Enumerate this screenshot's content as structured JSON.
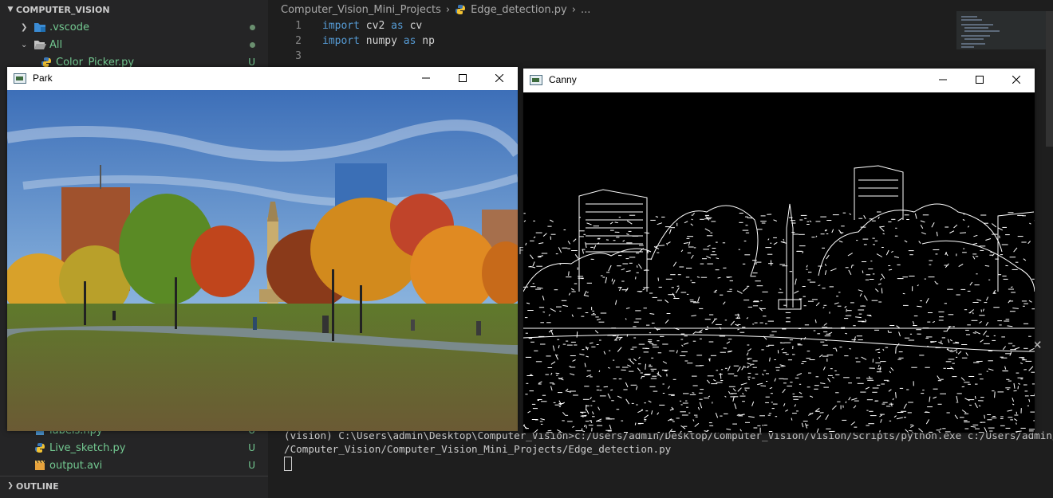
{
  "explorer": {
    "root_label": "COMPUTER_VISION",
    "items": [
      {
        "label": ".vscode",
        "status": "dot"
      },
      {
        "label": "All",
        "status": "dot"
      },
      {
        "label": "Color_Picker.py",
        "status": "U"
      },
      {
        "label": "labels.npy",
        "status": "U"
      },
      {
        "label": "Live_sketch.py",
        "status": "U"
      },
      {
        "label": "output.avi",
        "status": "U"
      }
    ],
    "outline_label": "OUTLINE"
  },
  "breadcrumb": {
    "folder": "Computer_Vision_Mini_Projects",
    "file": "Edge_detection.py",
    "more": "..."
  },
  "editor": {
    "lines": [
      {
        "num": "1",
        "kw1": "import",
        "mod": " cv2 ",
        "kw2": "as",
        "alias": " cv"
      },
      {
        "num": "2",
        "kw1": "import",
        "mod": " numpy ",
        "kw2": "as",
        "alias": " np"
      },
      {
        "num": "3",
        "kw1": "",
        "mod": "",
        "kw2": "",
        "alias": ""
      }
    ]
  },
  "terminal": {
    "line1": "(vision) C:\\Users\\admin\\Desktop\\Computer_Vision>c:/Users/admin/Desktop/Computer_Vision/vision/Scripts/python.exe c:/Users/admin/Desktop",
    "line2": "/Computer_Vision/Computer_Vision_Mini_Projects/Edge_detection.py",
    "close_glyph": "✕"
  },
  "windows": {
    "park": {
      "title": "Park",
      "minimize": "—",
      "maximize": "☐",
      "close": "✕"
    },
    "canny": {
      "title": "Canny",
      "minimize": "—",
      "maximize": "☐",
      "close": "✕"
    }
  },
  "colors": {
    "untracked": "#73c991",
    "keyword": "#569cd6",
    "sidebar": "#252526",
    "editor": "#1e1e1e"
  }
}
